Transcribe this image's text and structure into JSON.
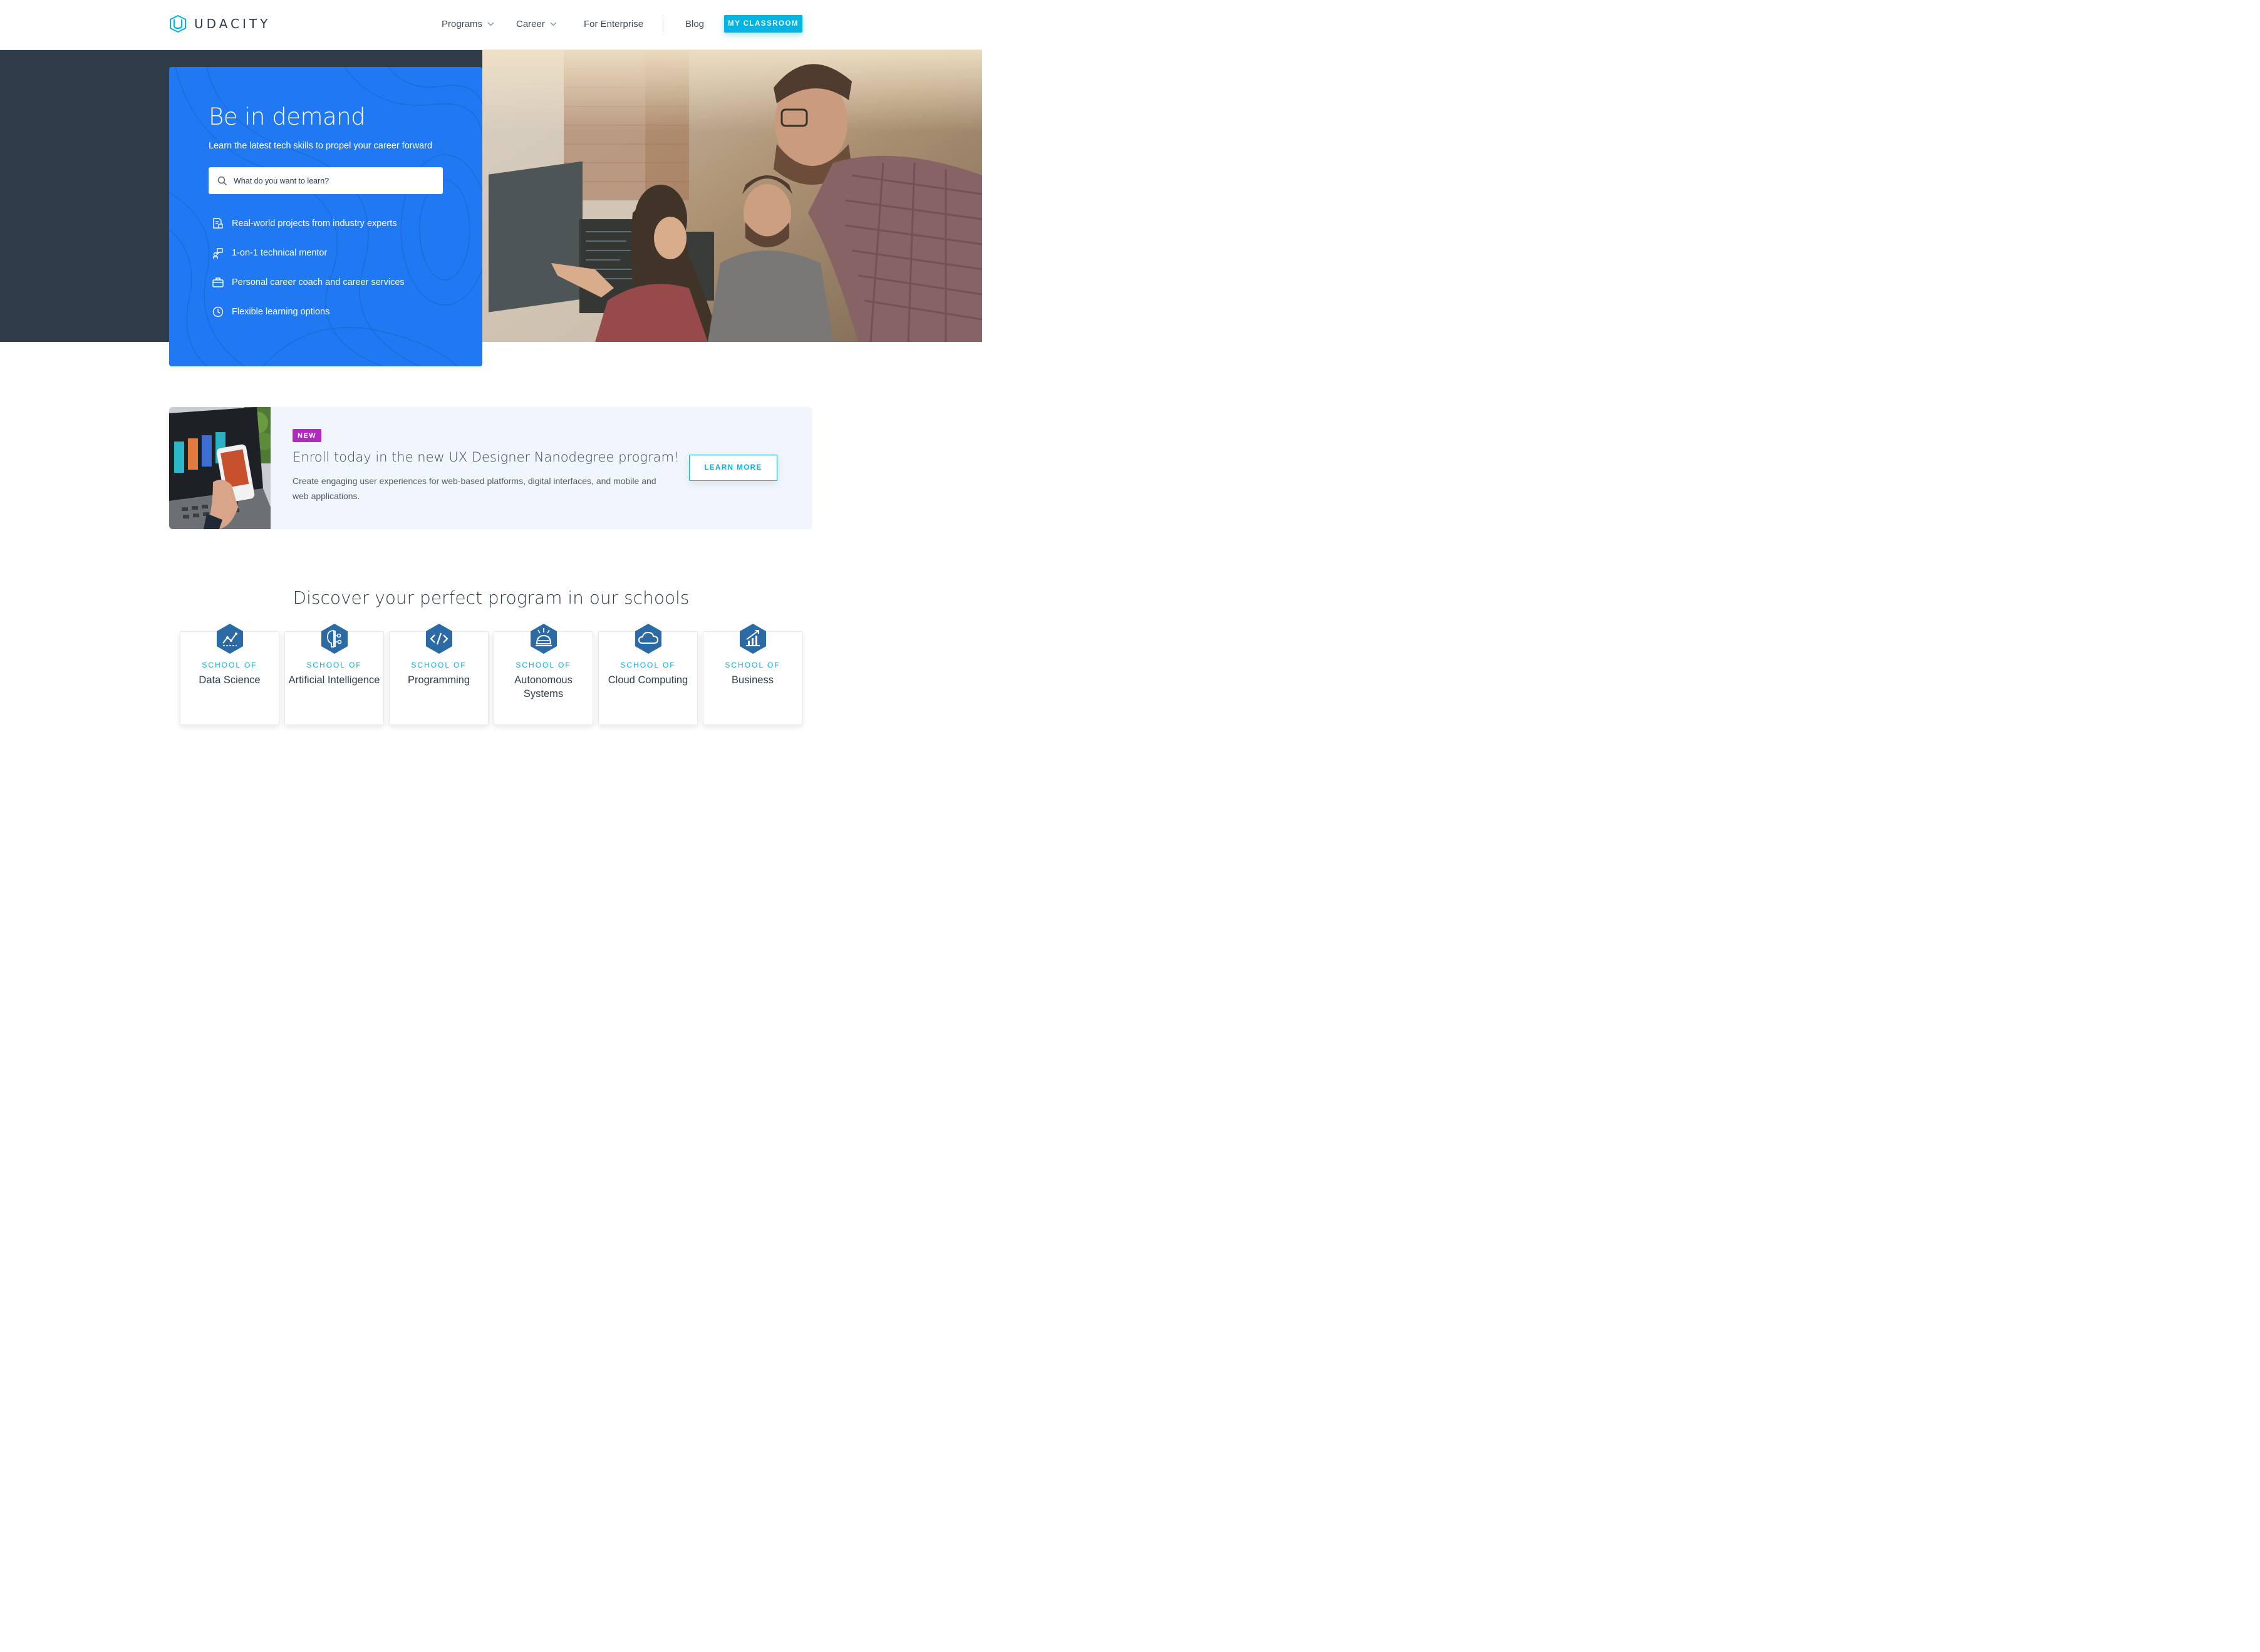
{
  "header": {
    "logo_text": "UDACITY",
    "nav": [
      {
        "label": "Programs",
        "dropdown": true
      },
      {
        "label": "Career",
        "dropdown": true
      },
      {
        "label": "For Enterprise",
        "dropdown": false
      },
      {
        "label": "Blog",
        "dropdown": false
      }
    ],
    "classroom_button": "MY CLASSROOM"
  },
  "hero": {
    "title": "Be in demand",
    "subtitle": "Learn the latest tech skills to propel your career forward",
    "search_placeholder": "What do you want to learn?",
    "features": [
      {
        "icon": "projects-icon",
        "label": "Real-world projects from industry experts"
      },
      {
        "icon": "mentor-icon",
        "label": "1-on-1 technical mentor"
      },
      {
        "icon": "briefcase-icon",
        "label": "Personal career coach and career services"
      },
      {
        "icon": "clock-icon",
        "label": "Flexible learning options"
      }
    ]
  },
  "promo": {
    "badge": "NEW",
    "title": "Enroll today in the new UX Designer Nanodegree program!",
    "description": "Create engaging user experiences for web-based platforms, digital interfaces, and mobile and web applications.",
    "button": "LEARN MORE"
  },
  "schools": {
    "heading": "Discover your perfect program in our schools",
    "prefix": "SCHOOL OF",
    "items": [
      {
        "name": "Data Science",
        "icon": "data-science-icon"
      },
      {
        "name": "Artificial Intelligence",
        "icon": "ai-icon"
      },
      {
        "name": "Programming",
        "icon": "code-icon"
      },
      {
        "name": "Autonomous Systems",
        "icon": "autonomous-icon"
      },
      {
        "name": "Cloud Computing",
        "icon": "cloud-icon"
      },
      {
        "name": "Business",
        "icon": "business-icon"
      }
    ]
  },
  "colors": {
    "brand_blue": "#2079f2",
    "accent_cyan": "#02b3e4",
    "dark_slate": "#2e3d49",
    "badge_purple": "#b02ac0",
    "school_icon": "#2c6aa6"
  }
}
